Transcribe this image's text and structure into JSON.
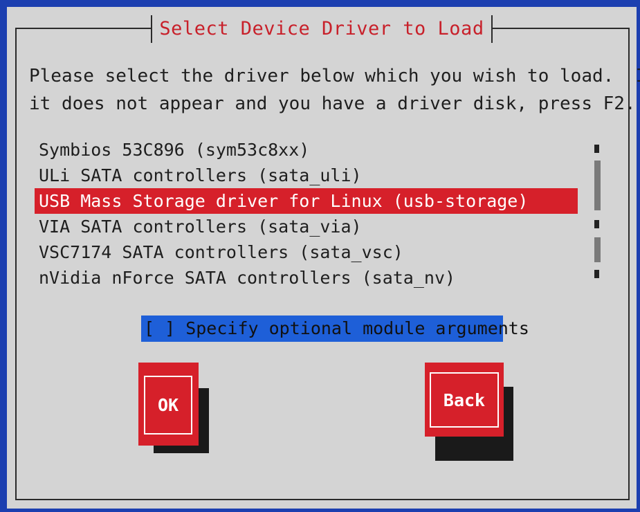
{
  "dialog": {
    "title": "Select Device Driver to Load",
    "intro_line1": "Please select the driver below which you wish to load.  If",
    "intro_line2": "it does not appear and you have a driver disk, press F2."
  },
  "drivers": [
    {
      "label": "Symbios 53C896 (sym53c8xx)",
      "selected": false
    },
    {
      "label": "ULi SATA controllers (sata_uli)",
      "selected": false
    },
    {
      "label": "USB Mass Storage driver for Linux (usb-storage)",
      "selected": true
    },
    {
      "label": "VIA SATA controllers (sata_via)",
      "selected": false
    },
    {
      "label": "VSC7174 SATA controllers (sata_vsc)",
      "selected": false
    },
    {
      "label": "nVidia nForce SATA controllers (sata_nv)",
      "selected": false
    }
  ],
  "options": {
    "module_args_checkbox": "[ ] Specify optional module arguments"
  },
  "buttons": {
    "ok_label": "OK",
    "back_label": "Back"
  },
  "colors": {
    "screen_background": "#1c3fb0",
    "dialog_background": "#d4d4d4",
    "title_text": "#c8202a",
    "selection_highlight": "#d6202a",
    "checkbox_highlight": "#1e5fd8",
    "button_face": "#d6202a"
  }
}
